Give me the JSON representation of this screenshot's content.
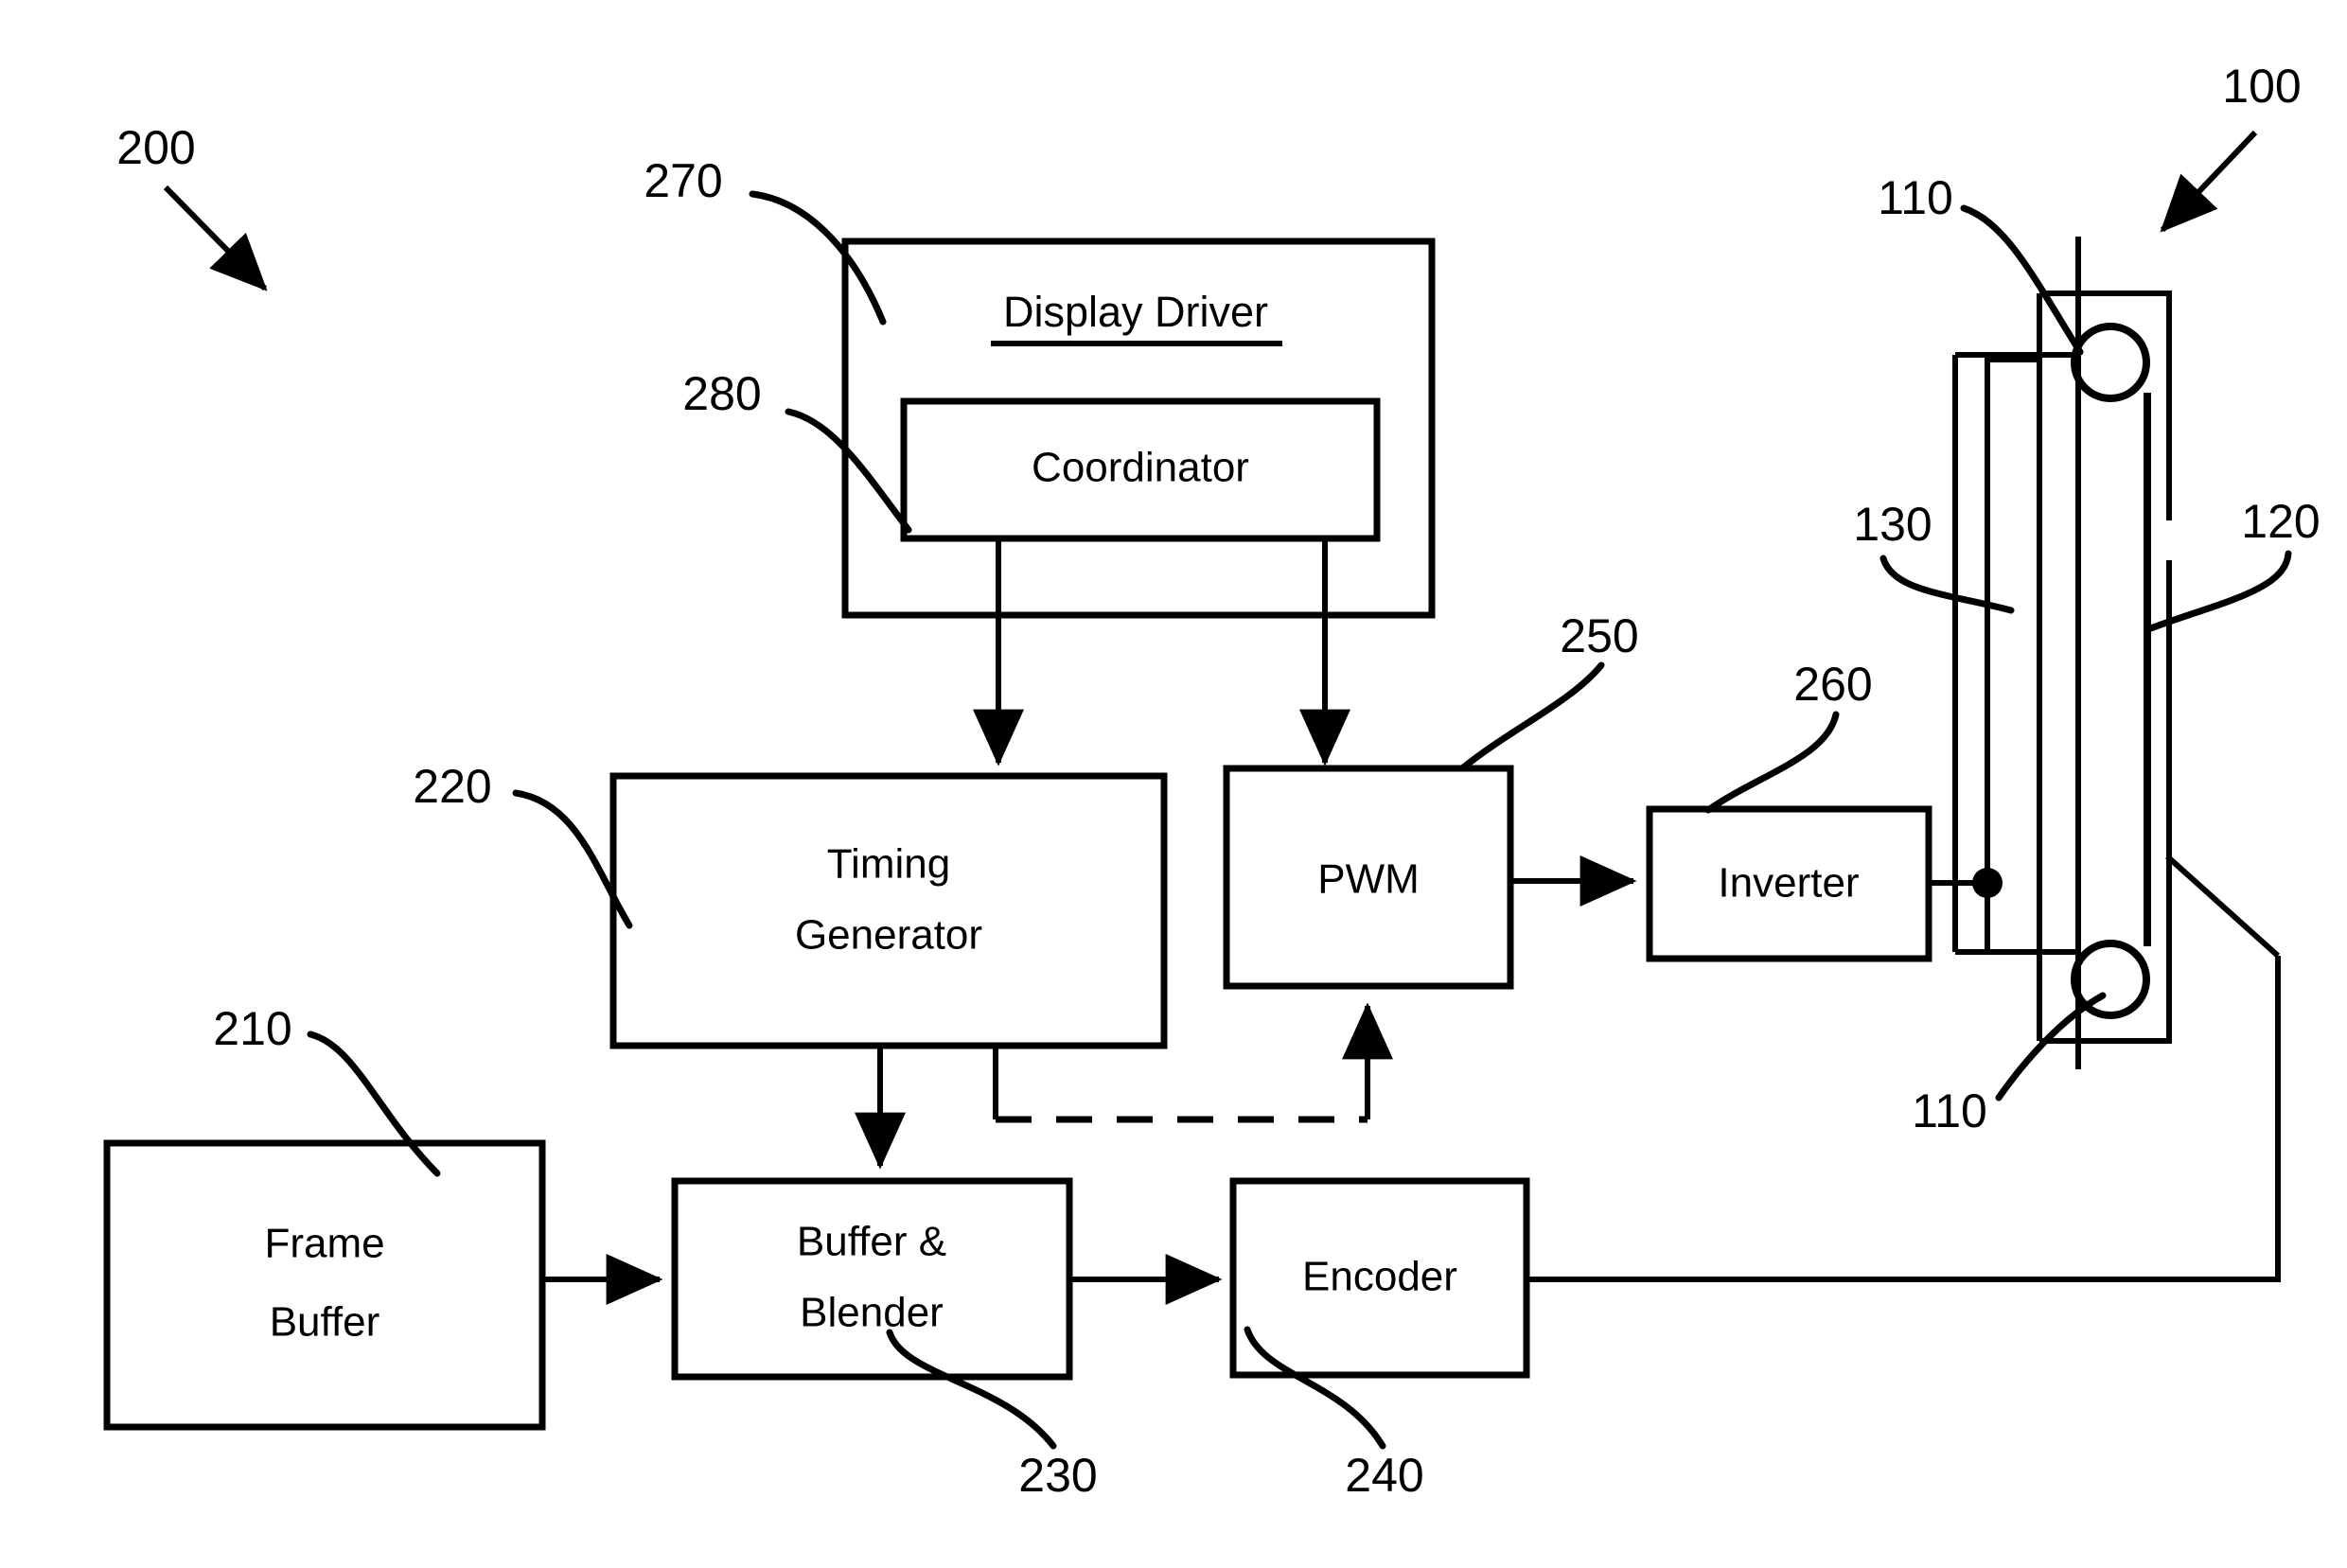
{
  "figure": {
    "type": "patent-block-diagram",
    "background_color": "#ffffff",
    "line_color": "#000000"
  },
  "blocks": {
    "display_driver": {
      "label": "Display Driver",
      "ref": "270",
      "underlined": true
    },
    "coordinator": {
      "label": "Coordinator",
      "ref": "280"
    },
    "timing_generator": {
      "label_line1": "Timing",
      "label_line2": "Generator",
      "ref": "220"
    },
    "pwm": {
      "label": "PWM",
      "ref": "250"
    },
    "inverter": {
      "label": "Inverter",
      "ref": "260"
    },
    "frame_buffer": {
      "label_line1": "Frame",
      "label_line2": "Buffer",
      "ref": "210"
    },
    "buffer_blender": {
      "label_line1": "Buffer &",
      "label_line2": "Blender",
      "ref": "230"
    },
    "encoder": {
      "label": "Encoder",
      "ref": "240"
    }
  },
  "reference_numerals": {
    "system": "200",
    "display_assembly": "100",
    "lamp_top": "110",
    "lamp_bottom": "110",
    "panel": "120",
    "backlight": "130",
    "display_driver": "270",
    "coordinator": "280",
    "frame_buffer": "210",
    "timing_generator": "220",
    "buffer_blender": "230",
    "encoder": "240",
    "pwm": "250",
    "inverter": "260"
  },
  "connections": [
    {
      "from": "coordinator",
      "to": "timing_generator",
      "style": "solid-arrow"
    },
    {
      "from": "coordinator",
      "to": "pwm",
      "style": "solid-arrow"
    },
    {
      "from": "timing_generator",
      "to": "buffer_blender",
      "style": "solid-arrow"
    },
    {
      "from": "timing_generator",
      "to": "pwm",
      "style": "dashed-arrow"
    },
    {
      "from": "frame_buffer",
      "to": "buffer_blender",
      "style": "solid-arrow"
    },
    {
      "from": "buffer_blender",
      "to": "encoder",
      "style": "solid-arrow"
    },
    {
      "from": "pwm",
      "to": "inverter",
      "style": "solid-arrow"
    },
    {
      "from": "inverter",
      "to": "lamps",
      "style": "solid-line"
    },
    {
      "from": "encoder",
      "to": "panel",
      "style": "solid-line"
    }
  ]
}
